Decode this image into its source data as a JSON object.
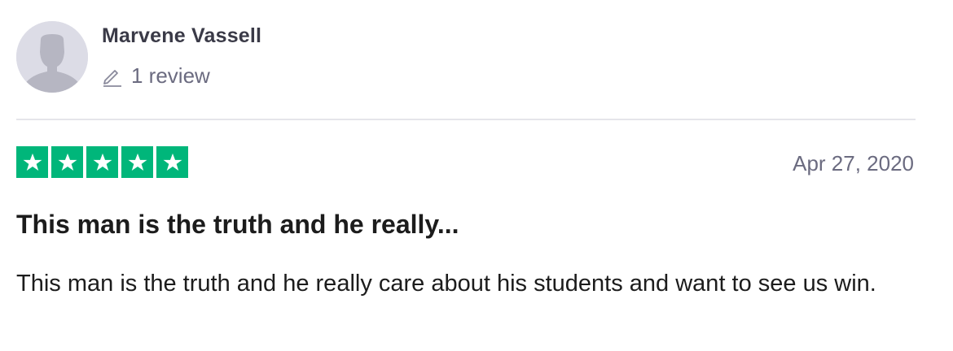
{
  "reviewer": {
    "name": "Marvene Vassell",
    "review_count": "1 review",
    "avatar_icon": "user-silhouette-icon"
  },
  "rating": {
    "stars": 5,
    "max_stars": 5,
    "star_color": "#00b67a",
    "star_icon": "star-icon"
  },
  "review": {
    "date": "Apr 27, 2020",
    "title": "This man is the truth and he really...",
    "body": "This man is the truth and he really care about his students and want to see us win."
  },
  "icons": {
    "review_count_icon": "pencil-icon"
  },
  "colors": {
    "name_text": "#3a3a47",
    "muted_text": "#6b6b80",
    "divider": "#e5e5ea",
    "avatar_bg": "#dcdce6",
    "avatar_fg": "#b6b6c2"
  }
}
